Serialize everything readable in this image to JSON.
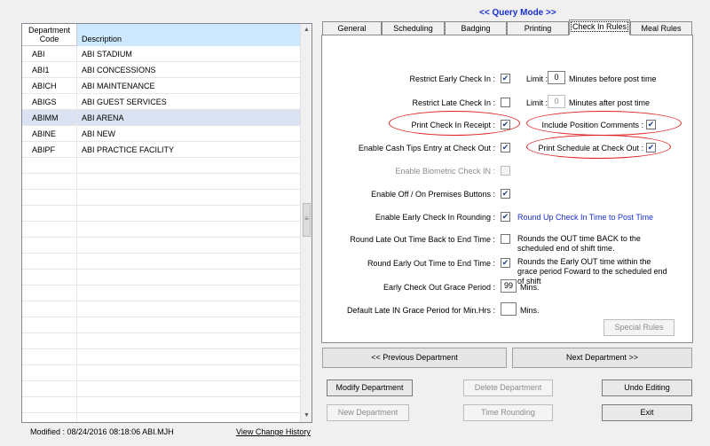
{
  "grid": {
    "col_code": "Department Code",
    "col_desc": "Description",
    "rows": [
      {
        "code": "ABI",
        "desc": "ABI STADIUM"
      },
      {
        "code": "ABI1",
        "desc": "ABI CONCESSIONS"
      },
      {
        "code": "ABICH",
        "desc": "ABI MAINTENANCE"
      },
      {
        "code": "ABIGS",
        "desc": "ABI GUEST SERVICES"
      },
      {
        "code": "ABIMM",
        "desc": "ABI ARENA"
      },
      {
        "code": "ABINE",
        "desc": "ABI NEW"
      },
      {
        "code": "ABIPF",
        "desc": "ABI PRACTICE FACILITY"
      }
    ],
    "selected_index": 4
  },
  "footer": {
    "modified": "Modified : 08/24/2016 08:18:06 ABI.MJH",
    "history_link": "View Change History"
  },
  "header": {
    "query_mode": "<< Query Mode >>"
  },
  "tabs": [
    "General",
    "Scheduling",
    "Badging",
    "Printing",
    "Check In Rules",
    "Meal Rules"
  ],
  "active_tab": "Check In Rules",
  "form": {
    "restrict_early_label": "Restrict Early Check In :",
    "restrict_early_checked": true,
    "limit_label_1": "Limit :",
    "limit_value_1": "0",
    "limit_suffix_1": "Minutes before post time",
    "restrict_late_label": "Restrict Late Check In :",
    "restrict_late_checked": false,
    "limit_label_2": "Limit :",
    "limit_value_2": "0",
    "limit_suffix_2": "Minutes after post time",
    "print_receipt_label": "Print Check In Receipt :",
    "print_receipt_checked": true,
    "include_position_label": "Include Position Comments :",
    "include_position_checked": true,
    "cash_tips_label": "Enable Cash Tips Entry at Check Out :",
    "cash_tips_checked": true,
    "print_schedule_label": "Print Schedule at Check Out :",
    "print_schedule_checked": true,
    "biometric_label": "Enable Biometric Check IN :",
    "biometric_checked": false,
    "off_on_label": "Enable Off / On Premises Buttons :",
    "off_on_checked": true,
    "early_rounding_label": "Enable Early Check In Rounding :",
    "early_rounding_checked": true,
    "early_rounding_note": "Round Up Check In Time to Post Time",
    "round_late_label": "Round Late Out Time Back to End Time :",
    "round_late_checked": false,
    "round_late_note": "Rounds the OUT time BACK to the scheduled end of shift time.",
    "round_early_label": "Round Early Out Time to End Time :",
    "round_early_checked": true,
    "round_early_note": "Rounds the Early OUT time within the grace period Foward to the scheduled end of shift",
    "grace_label": "Early Check Out Grace Period :",
    "grace_value": "99",
    "grace_suffix": "Mins.",
    "late_in_label": "Default Late IN Grace Period for Min.Hrs :",
    "late_in_value": "",
    "late_in_suffix": "Mins.",
    "special_rules": "Special Rules"
  },
  "buttons": {
    "prev_dept": "<< Previous Department",
    "next_dept": "Next Department >>",
    "modify": "Modify Department",
    "delete": "Delete Department",
    "undo": "Undo Editing",
    "new": "New Department",
    "time_rounding": "Time Rounding",
    "exit": "Exit"
  }
}
